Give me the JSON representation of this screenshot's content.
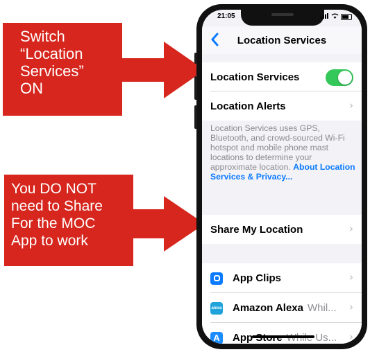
{
  "callouts": [
    {
      "lines": [
        "Switch",
        "“Location",
        "Services”",
        "ON"
      ]
    },
    {
      "lines": [
        "You DO NOT",
        "need to Share",
        "For the MOC",
        "App to work"
      ]
    }
  ],
  "status_bar": {
    "time": "21:05"
  },
  "nav": {
    "back_icon": "chevron-left-icon",
    "title": "Location Services"
  },
  "settings": {
    "location_services": {
      "label": "Location Services",
      "toggle_on": true
    },
    "location_alerts": {
      "label": "Location Alerts"
    },
    "footer": {
      "text": "Location Services uses GPS, Bluetooth, and crowd-sourced Wi-Fi hotspot and mobile phone mast locations to determine your approximate location.",
      "link": "About Location Services & Privacy..."
    },
    "share_my_location": {
      "label": "Share My Location"
    }
  },
  "apps": [
    {
      "icon": "app-clips-icon",
      "name": "App Clips",
      "detail": ""
    },
    {
      "icon": "alexa-icon",
      "icon_text": "alexa",
      "name": "Amazon Alexa",
      "detail": "Whil..."
    },
    {
      "icon": "app-store-icon",
      "icon_text": "A",
      "name": "App Store",
      "detail": "While Us..."
    }
  ],
  "colors": {
    "callout": "#d6261d",
    "toggle_on": "#34c759",
    "link": "#0a7aff"
  }
}
